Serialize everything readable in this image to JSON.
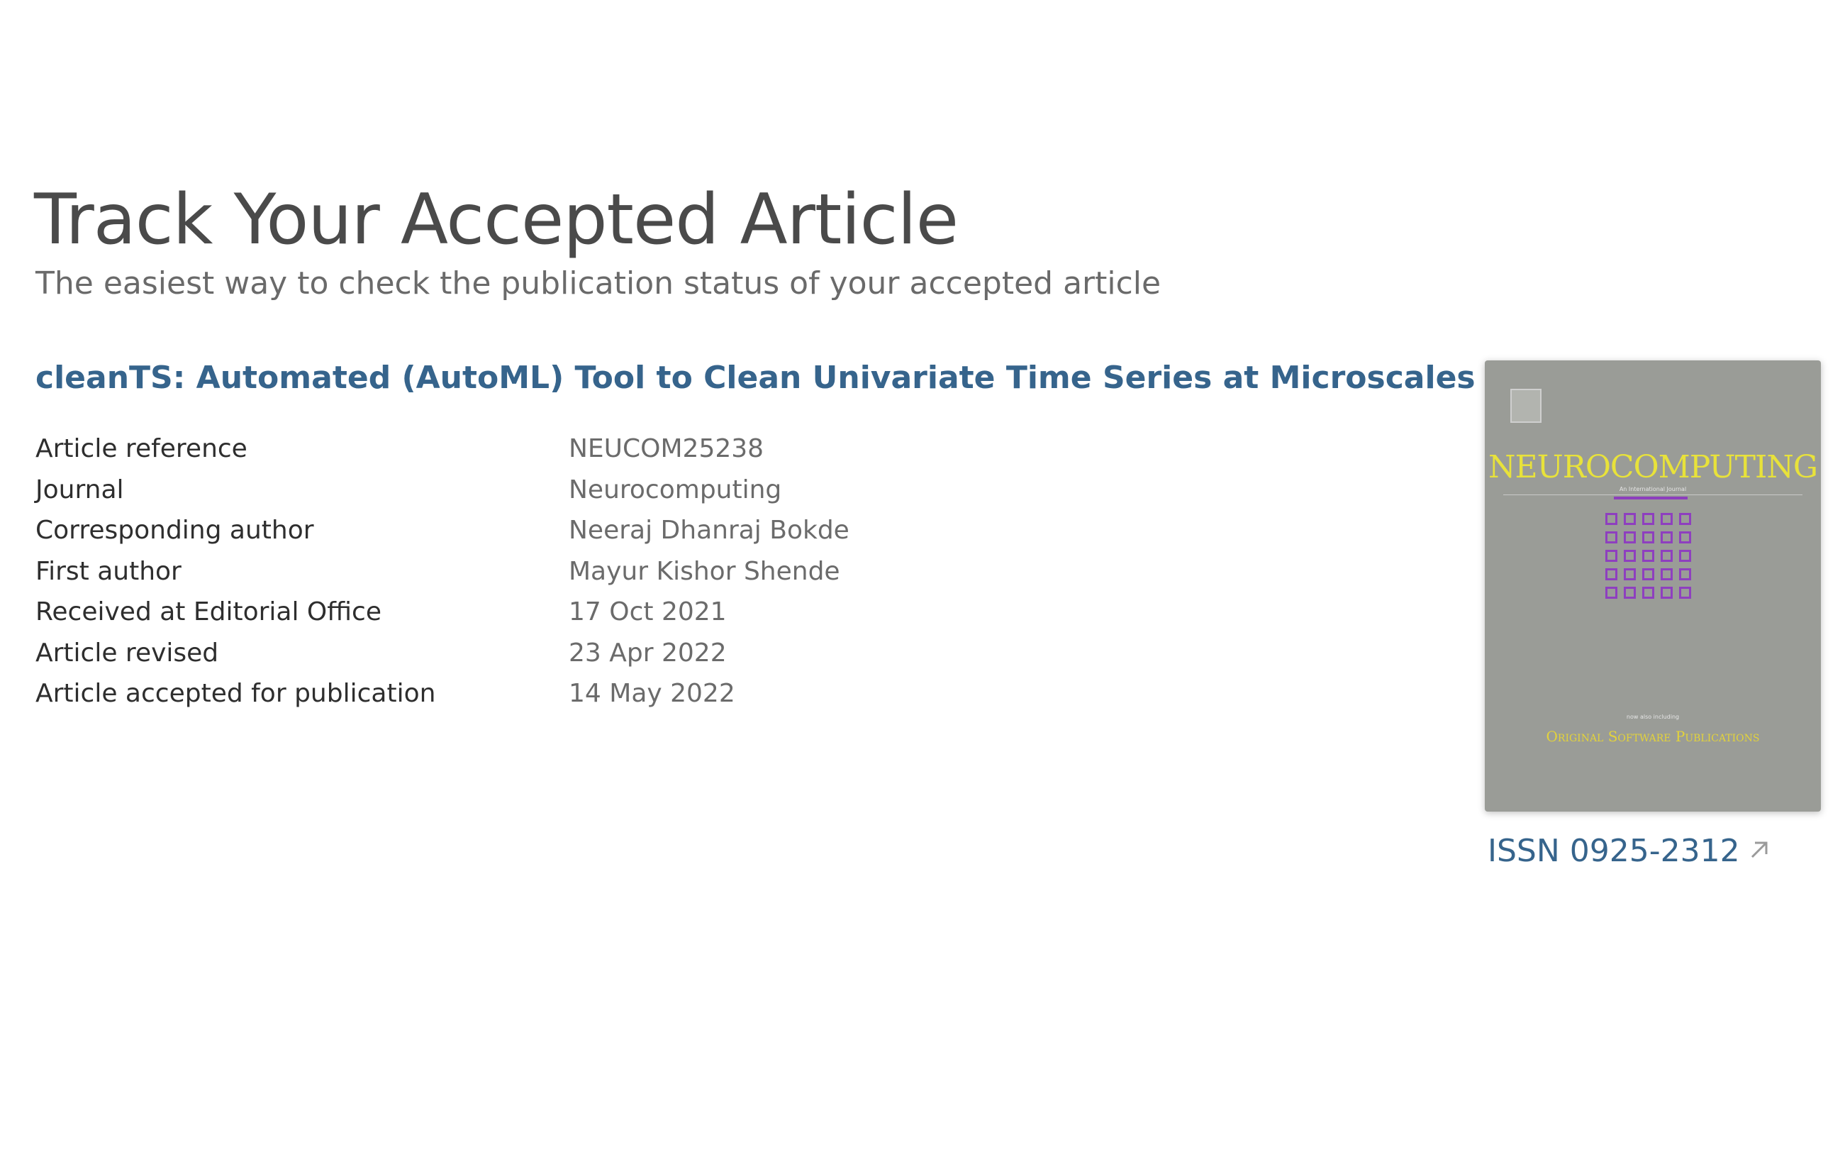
{
  "header": {
    "title": "Track Your Accepted Article",
    "subtitle": "The easiest way to check the publication status of your accepted article"
  },
  "article": {
    "title": "cleanTS: Automated (AutoML) Tool to Clean Univariate Time Series at Microscales",
    "details": [
      {
        "label": "Article reference",
        "value": "NEUCOM25238"
      },
      {
        "label": "Journal",
        "value": "Neurocomputing"
      },
      {
        "label": "Corresponding author",
        "value": "Neeraj Dhanraj Bokde"
      },
      {
        "label": "First author",
        "value": "Mayur Kishor Shende"
      },
      {
        "label": "Received at Editorial Office",
        "value": "17 Oct 2021"
      },
      {
        "label": "Article revised",
        "value": "23 Apr 2022"
      },
      {
        "label": "Article accepted for publication",
        "value": "14 May 2022"
      }
    ]
  },
  "journal_cover": {
    "journal_name": "Neurocomputing",
    "tagline": "An International Journal",
    "series_note": "now also including",
    "series": "Original Software Publications",
    "cover_color": "#9a9c97",
    "title_color": "#e8e23a",
    "accent_color": "#8e3fbf"
  },
  "issn": {
    "label": "ISSN 0925-2312",
    "icon": "external-link-arrow-icon"
  },
  "colors": {
    "link": "#36648c",
    "heading": "#4a4a4a",
    "value_text": "#6b6b6b"
  }
}
